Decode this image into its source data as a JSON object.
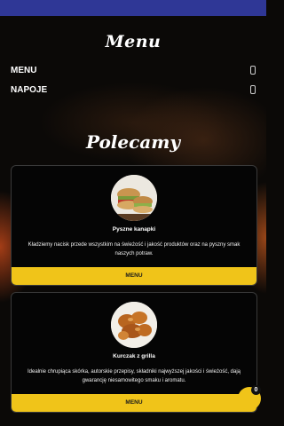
{
  "menu_title": "Menu",
  "nav": [
    {
      "label": "MENU"
    },
    {
      "label": "NAPOJE"
    }
  ],
  "section_title": "Polecamy",
  "cards": [
    {
      "name": "Pyszne kanapki",
      "description": "Kładziemy nacisk przede wszystkim na świeżość i jakość produktów oraz na pyszny smak naszych potraw.",
      "button": "MENU",
      "image": "sandwich-photo"
    },
    {
      "name": "Kurczak z grilla",
      "description": "Idealnie chrupiąca skórka, autorskie przepisy, składniki najwyższej jakości i świeżość, dają gwarancję niesamowitego smaku i aromatu.",
      "button": "MENU",
      "image": "grilled-chicken-photo"
    }
  ],
  "cart_badge": "0",
  "colors": {
    "accent": "#f0c419",
    "topbar": "#2f3796",
    "background": "#0b0907"
  }
}
